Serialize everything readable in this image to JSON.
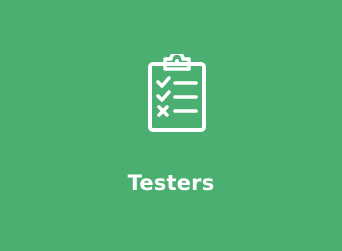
{
  "card": {
    "label": "Testers",
    "icon": "clipboard-checklist-icon",
    "background_color": "#4caf72",
    "foreground_color": "#ffffff"
  }
}
